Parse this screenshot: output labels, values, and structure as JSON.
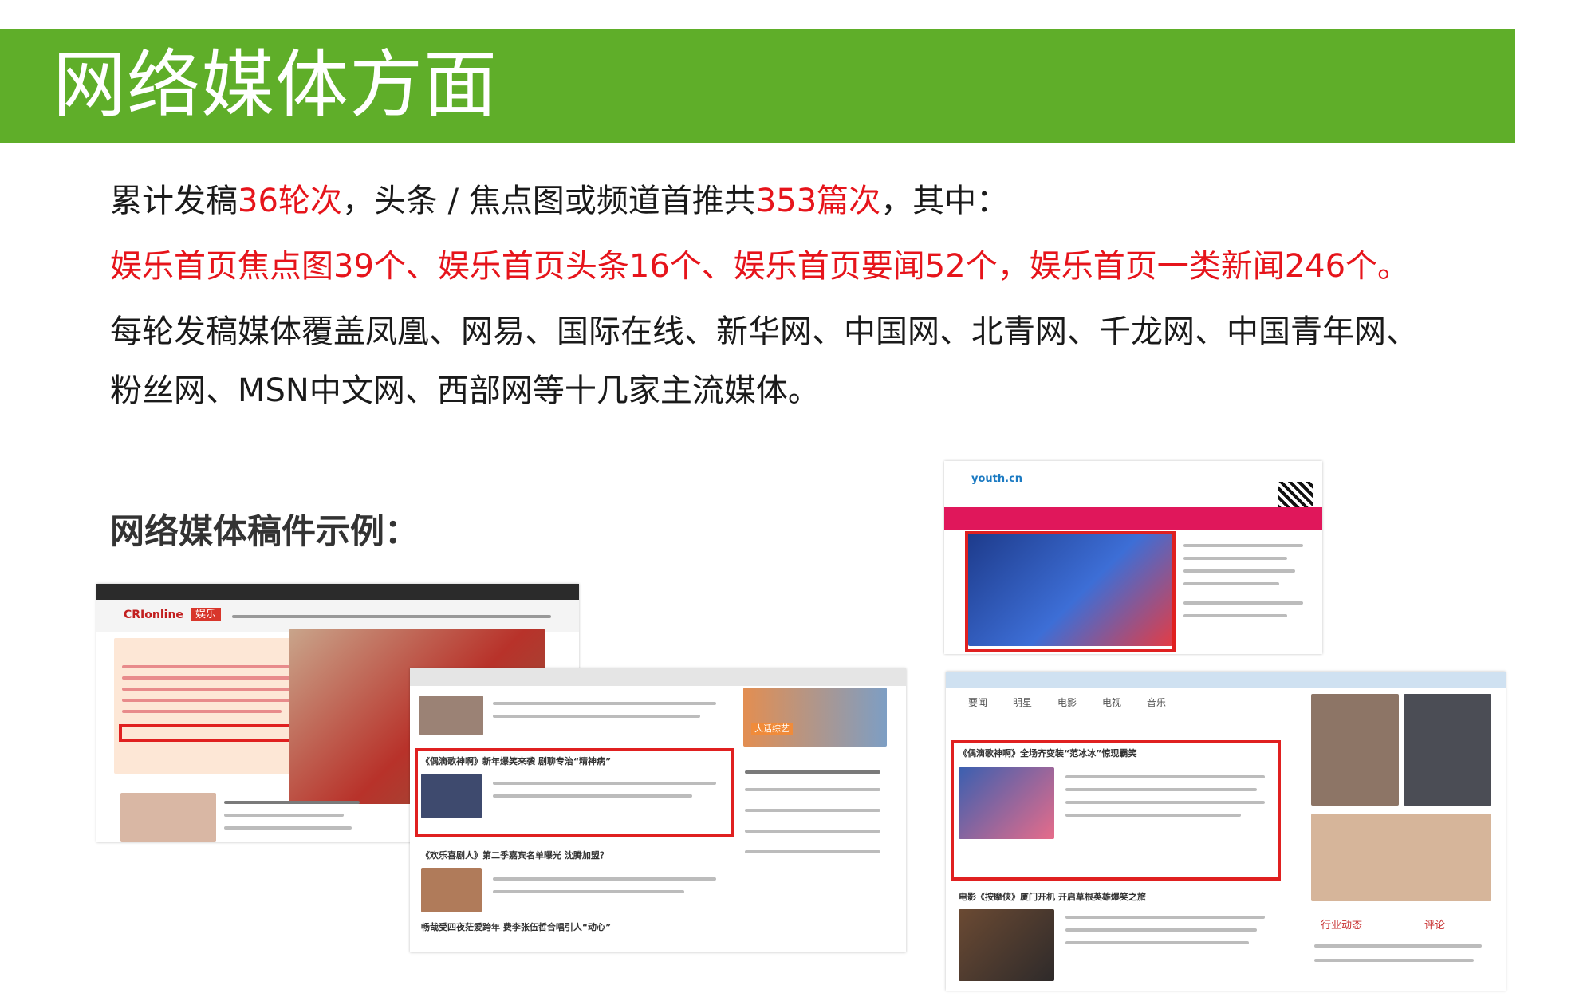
{
  "header": {
    "title": "网络媒体方面"
  },
  "summary": {
    "line1_prefix": "累计发稿",
    "line1_rounds": "36轮次",
    "line1_middle": "，头条 / 焦点图或频道首推共",
    "line1_count": "353篇次",
    "line1_suffix": "，其中：",
    "line2": "娱乐首页焦点图39个、娱乐首页头条16个、娱乐首页要闻52个，娱乐首页一类新闻246个。",
    "line3": "每轮发稿媒体覆盖凤凰、网易、国际在线、新华网、中国网、北青网、千龙网、中国青年网、",
    "line4": "粉丝网、MSN中文网、西部网等十几家主流媒体。"
  },
  "examples": {
    "heading": "网络媒体稿件示例：",
    "shot_cri": {
      "logo": "CRIonline",
      "tab": "娱乐"
    },
    "shot_163": {
      "headline1": "《偶滴歌神啊》新年爆笑来袭 剧聊专治“精神病”",
      "headline2": "《欢乐喜剧人》第二季嘉宾名单曝光 沈腾加盟？",
      "headline3": "畅哉受四夜茫爱跨年 费李张伍哲合唱引人“动心”",
      "badge": "大话综艺"
    },
    "shot_youth": {
      "logo": "youth.cn"
    },
    "shot_qq": {
      "tabs": [
        "要闻",
        "明星",
        "电影",
        "电视",
        "音乐"
      ],
      "headline1": "《偶滴歌神啊》全场齐变装“范冰冰”惊现霸笑",
      "headline2": "电影《按摩侠》厦门开机 开启草根英雄爆笑之旅",
      "sidebar_tabs": [
        "行业动态",
        "评论"
      ]
    }
  },
  "colors": {
    "accent_green": "#5fae29",
    "highlight_red": "#e6141b"
  }
}
